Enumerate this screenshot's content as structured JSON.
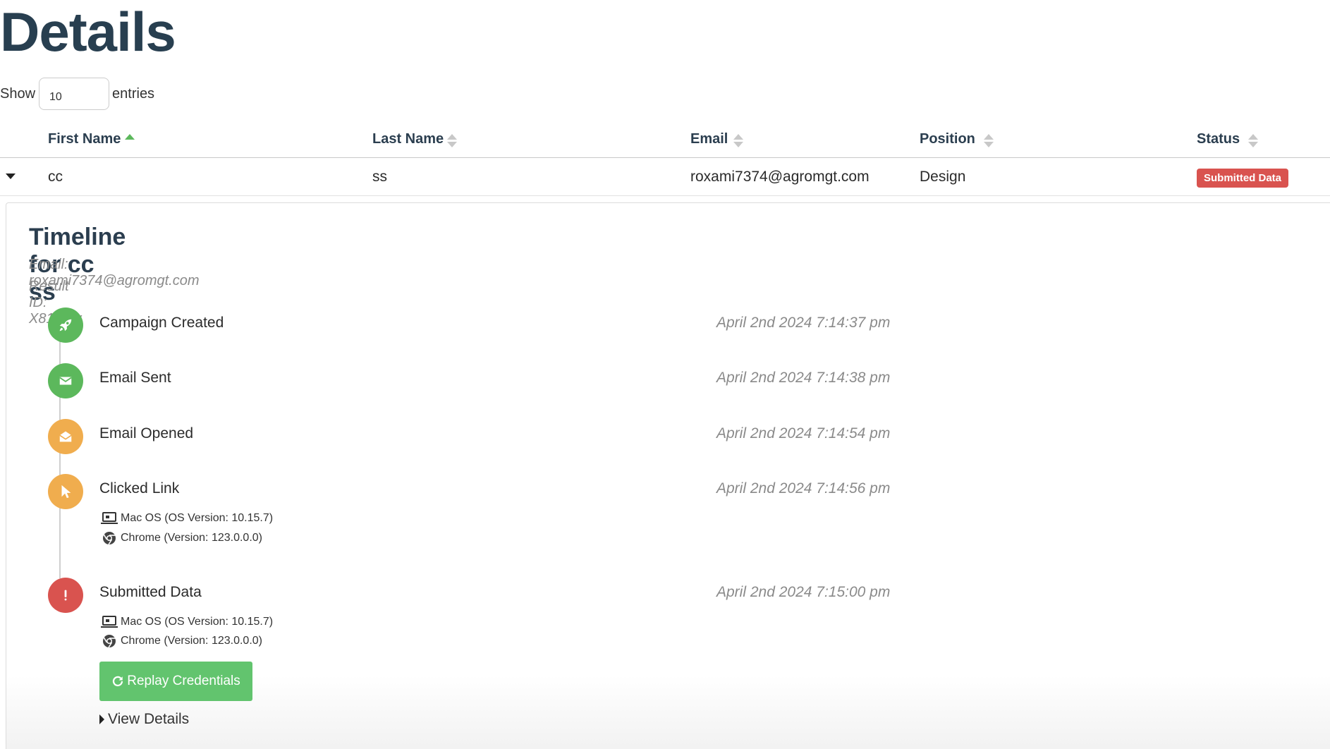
{
  "page": {
    "title": "Details"
  },
  "length": {
    "show_label": "Show",
    "value": "10",
    "entries_label": "entries"
  },
  "table": {
    "columns": [
      "First Name",
      "Last Name",
      "Email",
      "Position",
      "Status"
    ],
    "sorted_column": "First Name",
    "rows": [
      {
        "first_name": "cc",
        "last_name": "ss",
        "email": "roxami7374@agromgt.com",
        "position": "Design",
        "status": "Submitted Data"
      }
    ]
  },
  "timeline": {
    "title": "Timeline for cc ss",
    "email": "Email: roxami7374@agromgt.com",
    "result_id": "Result ID: X81Kztv",
    "events": [
      {
        "label": "Campaign Created",
        "time": "April 2nd 2024 7:14:37 pm",
        "icon": "rocket-icon",
        "color": "#5cb85c"
      },
      {
        "label": "Email Sent",
        "time": "April 2nd 2024 7:14:38 pm",
        "icon": "envelope-icon",
        "color": "#5cb85c"
      },
      {
        "label": "Email Opened",
        "time": "April 2nd 2024 7:14:54 pm",
        "icon": "envelope-open-icon",
        "color": "#f0ad4e"
      },
      {
        "label": "Clicked Link",
        "time": "April 2nd 2024 7:14:56 pm",
        "icon": "pointer-icon",
        "color": "#f0ad4e",
        "os": "Mac OS (OS Version: 10.15.7)",
        "browser": "Chrome (Version: 123.0.0.0)"
      },
      {
        "label": "Submitted Data",
        "time": "April 2nd 2024 7:15:00 pm",
        "icon": "exclamation-icon",
        "color": "#d9534f",
        "os": "Mac OS (OS Version: 10.15.7)",
        "browser": "Chrome (Version: 123.0.0.0)"
      }
    ],
    "replay_label": "Replay Credentials",
    "view_details_label": "View Details"
  },
  "colors": {
    "success": "#5cb85c",
    "warning": "#f0ad4e",
    "danger": "#d9534f",
    "button_green": "#62c46e",
    "heading": "#283f50"
  }
}
